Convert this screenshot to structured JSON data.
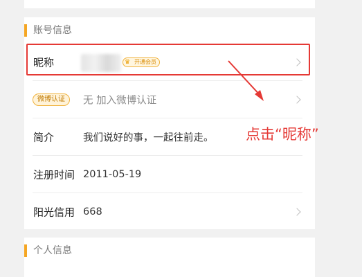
{
  "account_section": {
    "title": "账号信息"
  },
  "rows": {
    "nickname": {
      "label": "昵称",
      "vip_badge": "开通会员",
      "vip_icon": "crown-icon"
    },
    "weibo_verify": {
      "badge": "微博认证",
      "value": "无 加入微博认证"
    },
    "intro": {
      "label": "简介",
      "value": "我们说好的事，一起往前走。"
    },
    "register_time": {
      "label": "注册时间",
      "value": "2011-05-19"
    },
    "credit": {
      "label": "阳光信用",
      "value": "668"
    }
  },
  "personal_section": {
    "title": "个人信息"
  },
  "annotation": {
    "text": "点击“昵称”",
    "color": "#e53935"
  },
  "colors": {
    "accent": "#f5a623",
    "highlight": "#e53935"
  }
}
